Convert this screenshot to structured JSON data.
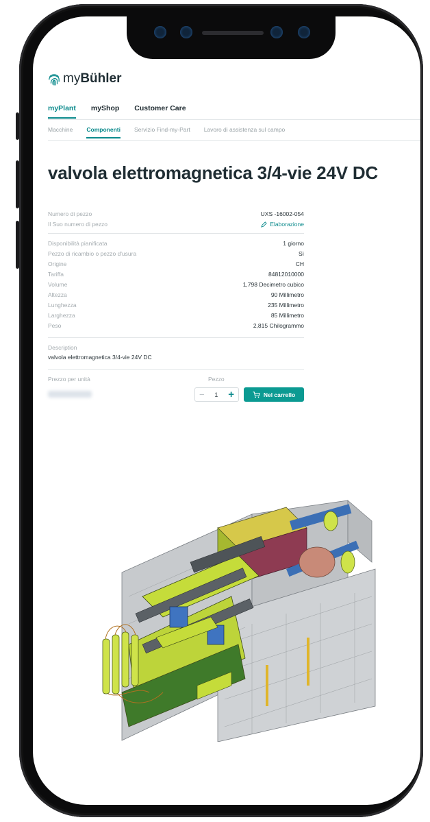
{
  "brand": {
    "prefix": "my",
    "name": "Bühler"
  },
  "nav_primary": [
    {
      "label": "myPlant",
      "active": true
    },
    {
      "label": "myShop",
      "active": false
    },
    {
      "label": "Customer Care",
      "active": false
    }
  ],
  "nav_secondary": [
    {
      "label": "Macchine",
      "active": false
    },
    {
      "label": "Componenti",
      "active": true
    },
    {
      "label": "Servizio Find-my-Part",
      "active": false
    },
    {
      "label": "Lavoro di assistenza sul campo",
      "active": false
    }
  ],
  "product": {
    "title": "valvola elettromagnetica 3/4-vie 24V DC",
    "part_number_label": "Numero di pezzo",
    "part_number": "UXS -16002-054",
    "own_number_label": "Il Suo numero di pezzo",
    "edit_label": "Elaborazione",
    "attributes": [
      {
        "label": "Disponibilità pianificata",
        "value": "1 giorno"
      },
      {
        "label": "Pezzo di ricambio o pezzo d'usura",
        "value": "Sì"
      },
      {
        "label": "Origine",
        "value": "CH"
      },
      {
        "label": "Tariffa",
        "value": "84812010000"
      },
      {
        "label": "Volume",
        "value": "1,798 Decimetro cubico"
      },
      {
        "label": "Altezza",
        "value": "90 Millimetro"
      },
      {
        "label": "Lunghezza",
        "value": "235 Millimetro"
      },
      {
        "label": "Larghezza",
        "value": "85 Millimetro"
      },
      {
        "label": "Peso",
        "value": "2,815 Chilogrammo"
      }
    ],
    "description_label": "Description",
    "description": "valvola elettromagnetica 3/4-vie 24V DC",
    "price_label": "Prezzo per unità",
    "quantity_label": "Pezzo",
    "quantity": "1",
    "minus": "−",
    "plus": "+",
    "cart_label": "Nel carrello"
  },
  "colors": {
    "accent": "#0b8a8c",
    "button": "#0b9a92",
    "text": "#1f2d33"
  }
}
